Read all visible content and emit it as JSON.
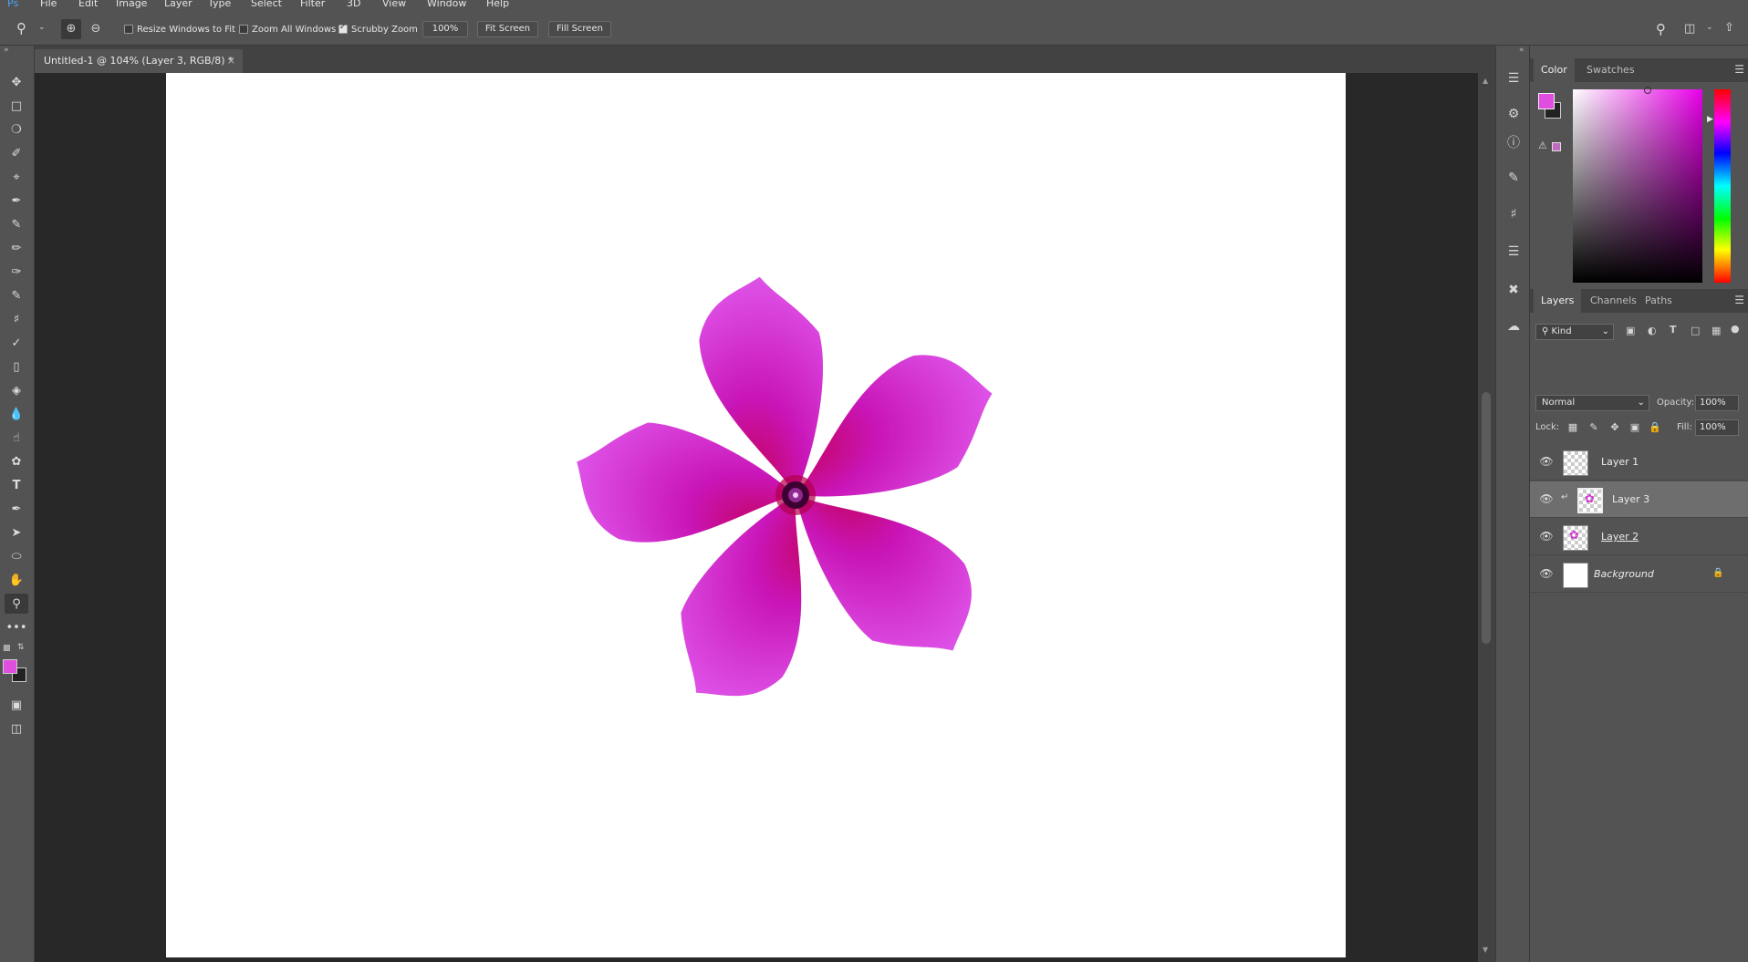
{
  "menu": [
    "File",
    "Edit",
    "Image",
    "Layer",
    "Type",
    "Select",
    "Filter",
    "3D",
    "View",
    "Window",
    "Help"
  ],
  "options": {
    "resize_windows": "Resize Windows to Fit",
    "zoom_all": "Zoom All Windows",
    "scrubby_zoom": "Scrubby Zoom",
    "zoom_value": "100%",
    "fit_screen": "Fit Screen",
    "fill_screen": "Fill Screen"
  },
  "document": {
    "tab_title": "Untitled-1 @ 104% (Layer 3, RGB/8) *",
    "close": "×"
  },
  "colors": {
    "foreground": "#e04ee0",
    "background": "#222222",
    "accent_magenta": "#e800e8"
  },
  "panels": {
    "color_tabs": [
      "Color",
      "Swatches"
    ],
    "layers_tabs": [
      "Layers",
      "Channels",
      "Paths"
    ],
    "filter_kind": "Kind",
    "blend_mode": "Normal",
    "opacity_label": "Opacity:",
    "opacity_value": "100%",
    "lock_label": "Lock:",
    "fill_label": "Fill:",
    "fill_value": "100%"
  },
  "layers": [
    {
      "name": "Layer 1"
    },
    {
      "name": "Layer 3"
    },
    {
      "name": "Layer 2"
    },
    {
      "name": "Background"
    }
  ]
}
